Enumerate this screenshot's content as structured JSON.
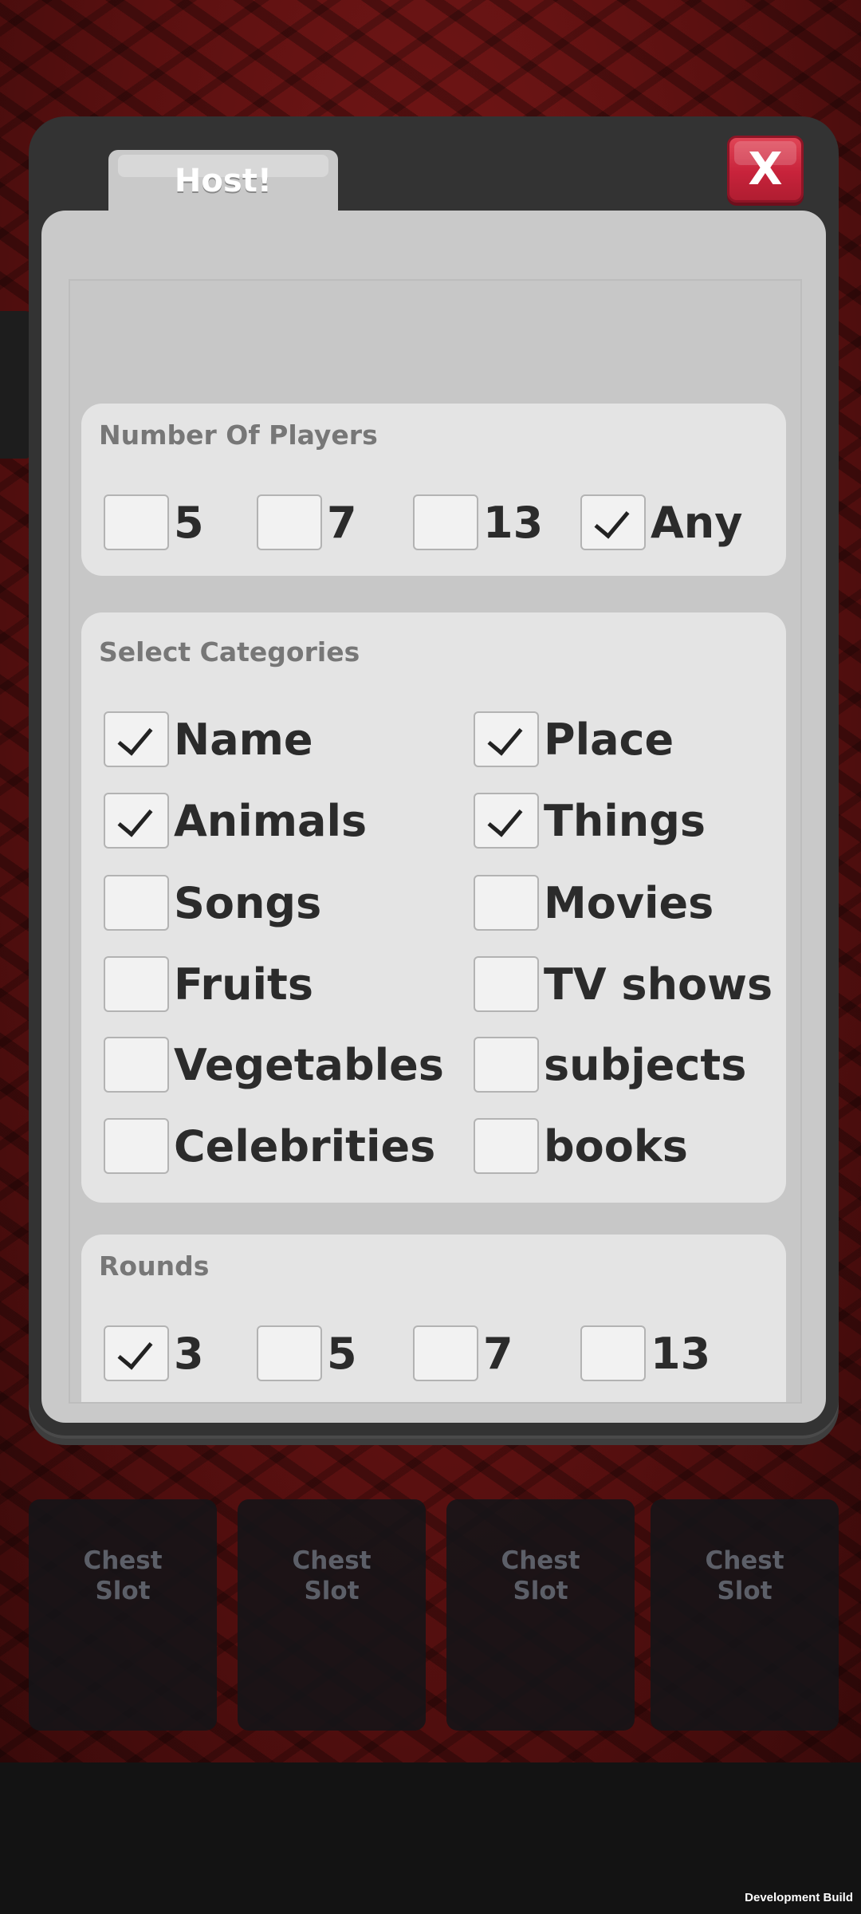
{
  "modal": {
    "tab_label": "Host!",
    "close_label": "X"
  },
  "players": {
    "title": "Number Of Players",
    "options": [
      {
        "label": "5",
        "checked": false
      },
      {
        "label": "7",
        "checked": false
      },
      {
        "label": "13",
        "checked": false
      },
      {
        "label": "Any",
        "checked": true
      }
    ]
  },
  "categories": {
    "title": "Select Categories",
    "options": [
      {
        "label": "Name",
        "checked": true
      },
      {
        "label": "Place",
        "checked": true
      },
      {
        "label": "Animals",
        "checked": true
      },
      {
        "label": "Things",
        "checked": true
      },
      {
        "label": "Songs",
        "checked": false
      },
      {
        "label": "Movies",
        "checked": false
      },
      {
        "label": "Fruits",
        "checked": false
      },
      {
        "label": "TV shows",
        "checked": false
      },
      {
        "label": "Vegetables",
        "checked": false
      },
      {
        "label": "subjects",
        "checked": false
      },
      {
        "label": "Celebrities",
        "checked": false
      },
      {
        "label": "books",
        "checked": false
      }
    ]
  },
  "rounds": {
    "title": "Rounds",
    "options": [
      {
        "label": "3",
        "checked": true
      },
      {
        "label": "5",
        "checked": false
      },
      {
        "label": "7",
        "checked": false
      },
      {
        "label": "13",
        "checked": false
      }
    ]
  },
  "chests": [
    {
      "label": "Chest\nSlot"
    },
    {
      "label": "Chest\nSlot"
    },
    {
      "label": "Chest\nSlot"
    },
    {
      "label": "Chest\nSlot"
    }
  ],
  "footer": {
    "build_label": "Development Build"
  }
}
